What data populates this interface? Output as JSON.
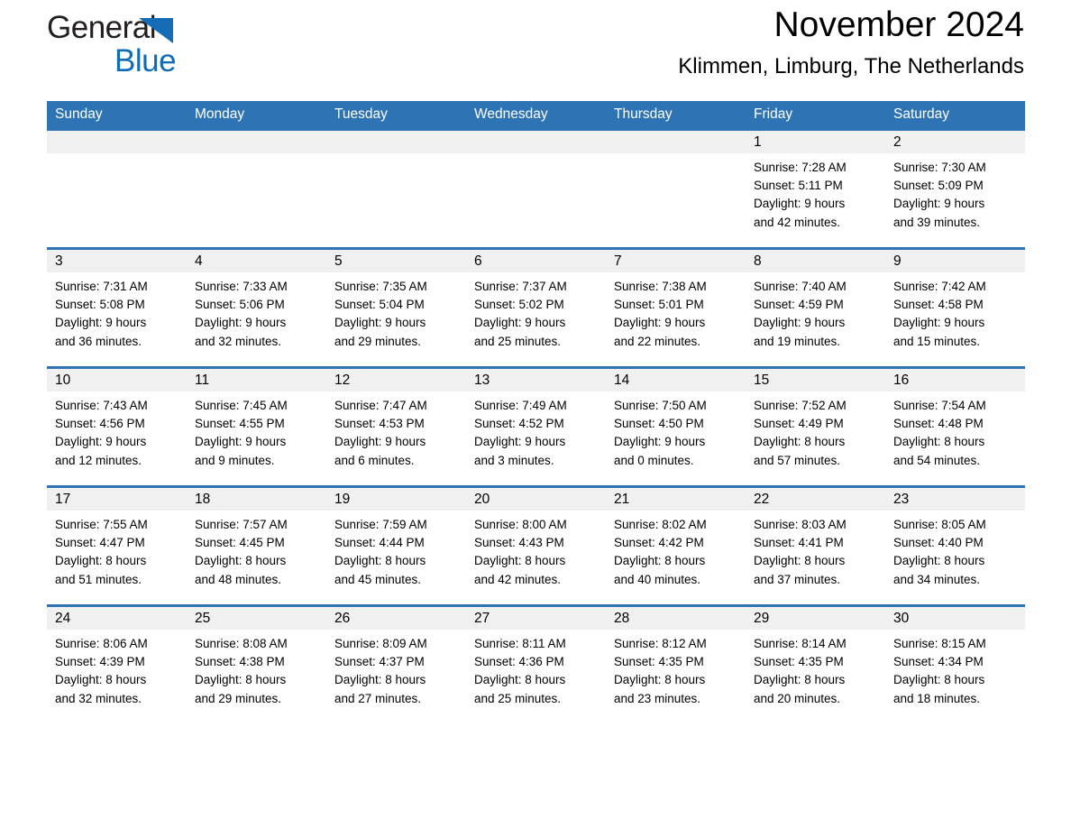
{
  "brand": {
    "name_part1": "General",
    "name_part2": "Blue",
    "triangle_color": "#146cb4",
    "text_color": "#231f20",
    "blue_color": "#0f6cb6"
  },
  "header": {
    "title": "November 2024",
    "subtitle": "Klimmen, Limburg, The Netherlands"
  },
  "theme": {
    "header_blue": "#2e74b5",
    "day_head_gray": "#f0f0f0",
    "cell_white": "#ffffff"
  },
  "weekdays": [
    "Sunday",
    "Monday",
    "Tuesday",
    "Wednesday",
    "Thursday",
    "Friday",
    "Saturday"
  ],
  "weeks": [
    [
      {
        "date": "",
        "sunrise": "",
        "sunset": "",
        "daylight1": "",
        "daylight2": ""
      },
      {
        "date": "",
        "sunrise": "",
        "sunset": "",
        "daylight1": "",
        "daylight2": ""
      },
      {
        "date": "",
        "sunrise": "",
        "sunset": "",
        "daylight1": "",
        "daylight2": ""
      },
      {
        "date": "",
        "sunrise": "",
        "sunset": "",
        "daylight1": "",
        "daylight2": ""
      },
      {
        "date": "",
        "sunrise": "",
        "sunset": "",
        "daylight1": "",
        "daylight2": ""
      },
      {
        "date": "1",
        "sunrise": "Sunrise: 7:28 AM",
        "sunset": "Sunset: 5:11 PM",
        "daylight1": "Daylight: 9 hours",
        "daylight2": "and 42 minutes."
      },
      {
        "date": "2",
        "sunrise": "Sunrise: 7:30 AM",
        "sunset": "Sunset: 5:09 PM",
        "daylight1": "Daylight: 9 hours",
        "daylight2": "and 39 minutes."
      }
    ],
    [
      {
        "date": "3",
        "sunrise": "Sunrise: 7:31 AM",
        "sunset": "Sunset: 5:08 PM",
        "daylight1": "Daylight: 9 hours",
        "daylight2": "and 36 minutes."
      },
      {
        "date": "4",
        "sunrise": "Sunrise: 7:33 AM",
        "sunset": "Sunset: 5:06 PM",
        "daylight1": "Daylight: 9 hours",
        "daylight2": "and 32 minutes."
      },
      {
        "date": "5",
        "sunrise": "Sunrise: 7:35 AM",
        "sunset": "Sunset: 5:04 PM",
        "daylight1": "Daylight: 9 hours",
        "daylight2": "and 29 minutes."
      },
      {
        "date": "6",
        "sunrise": "Sunrise: 7:37 AM",
        "sunset": "Sunset: 5:02 PM",
        "daylight1": "Daylight: 9 hours",
        "daylight2": "and 25 minutes."
      },
      {
        "date": "7",
        "sunrise": "Sunrise: 7:38 AM",
        "sunset": "Sunset: 5:01 PM",
        "daylight1": "Daylight: 9 hours",
        "daylight2": "and 22 minutes."
      },
      {
        "date": "8",
        "sunrise": "Sunrise: 7:40 AM",
        "sunset": "Sunset: 4:59 PM",
        "daylight1": "Daylight: 9 hours",
        "daylight2": "and 19 minutes."
      },
      {
        "date": "9",
        "sunrise": "Sunrise: 7:42 AM",
        "sunset": "Sunset: 4:58 PM",
        "daylight1": "Daylight: 9 hours",
        "daylight2": "and 15 minutes."
      }
    ],
    [
      {
        "date": "10",
        "sunrise": "Sunrise: 7:43 AM",
        "sunset": "Sunset: 4:56 PM",
        "daylight1": "Daylight: 9 hours",
        "daylight2": "and 12 minutes."
      },
      {
        "date": "11",
        "sunrise": "Sunrise: 7:45 AM",
        "sunset": "Sunset: 4:55 PM",
        "daylight1": "Daylight: 9 hours",
        "daylight2": "and 9 minutes."
      },
      {
        "date": "12",
        "sunrise": "Sunrise: 7:47 AM",
        "sunset": "Sunset: 4:53 PM",
        "daylight1": "Daylight: 9 hours",
        "daylight2": "and 6 minutes."
      },
      {
        "date": "13",
        "sunrise": "Sunrise: 7:49 AM",
        "sunset": "Sunset: 4:52 PM",
        "daylight1": "Daylight: 9 hours",
        "daylight2": "and 3 minutes."
      },
      {
        "date": "14",
        "sunrise": "Sunrise: 7:50 AM",
        "sunset": "Sunset: 4:50 PM",
        "daylight1": "Daylight: 9 hours",
        "daylight2": "and 0 minutes."
      },
      {
        "date": "15",
        "sunrise": "Sunrise: 7:52 AM",
        "sunset": "Sunset: 4:49 PM",
        "daylight1": "Daylight: 8 hours",
        "daylight2": "and 57 minutes."
      },
      {
        "date": "16",
        "sunrise": "Sunrise: 7:54 AM",
        "sunset": "Sunset: 4:48 PM",
        "daylight1": "Daylight: 8 hours",
        "daylight2": "and 54 minutes."
      }
    ],
    [
      {
        "date": "17",
        "sunrise": "Sunrise: 7:55 AM",
        "sunset": "Sunset: 4:47 PM",
        "daylight1": "Daylight: 8 hours",
        "daylight2": "and 51 minutes."
      },
      {
        "date": "18",
        "sunrise": "Sunrise: 7:57 AM",
        "sunset": "Sunset: 4:45 PM",
        "daylight1": "Daylight: 8 hours",
        "daylight2": "and 48 minutes."
      },
      {
        "date": "19",
        "sunrise": "Sunrise: 7:59 AM",
        "sunset": "Sunset: 4:44 PM",
        "daylight1": "Daylight: 8 hours",
        "daylight2": "and 45 minutes."
      },
      {
        "date": "20",
        "sunrise": "Sunrise: 8:00 AM",
        "sunset": "Sunset: 4:43 PM",
        "daylight1": "Daylight: 8 hours",
        "daylight2": "and 42 minutes."
      },
      {
        "date": "21",
        "sunrise": "Sunrise: 8:02 AM",
        "sunset": "Sunset: 4:42 PM",
        "daylight1": "Daylight: 8 hours",
        "daylight2": "and 40 minutes."
      },
      {
        "date": "22",
        "sunrise": "Sunrise: 8:03 AM",
        "sunset": "Sunset: 4:41 PM",
        "daylight1": "Daylight: 8 hours",
        "daylight2": "and 37 minutes."
      },
      {
        "date": "23",
        "sunrise": "Sunrise: 8:05 AM",
        "sunset": "Sunset: 4:40 PM",
        "daylight1": "Daylight: 8 hours",
        "daylight2": "and 34 minutes."
      }
    ],
    [
      {
        "date": "24",
        "sunrise": "Sunrise: 8:06 AM",
        "sunset": "Sunset: 4:39 PM",
        "daylight1": "Daylight: 8 hours",
        "daylight2": "and 32 minutes."
      },
      {
        "date": "25",
        "sunrise": "Sunrise: 8:08 AM",
        "sunset": "Sunset: 4:38 PM",
        "daylight1": "Daylight: 8 hours",
        "daylight2": "and 29 minutes."
      },
      {
        "date": "26",
        "sunrise": "Sunrise: 8:09 AM",
        "sunset": "Sunset: 4:37 PM",
        "daylight1": "Daylight: 8 hours",
        "daylight2": "and 27 minutes."
      },
      {
        "date": "27",
        "sunrise": "Sunrise: 8:11 AM",
        "sunset": "Sunset: 4:36 PM",
        "daylight1": "Daylight: 8 hours",
        "daylight2": "and 25 minutes."
      },
      {
        "date": "28",
        "sunrise": "Sunrise: 8:12 AM",
        "sunset": "Sunset: 4:35 PM",
        "daylight1": "Daylight: 8 hours",
        "daylight2": "and 23 minutes."
      },
      {
        "date": "29",
        "sunrise": "Sunrise: 8:14 AM",
        "sunset": "Sunset: 4:35 PM",
        "daylight1": "Daylight: 8 hours",
        "daylight2": "and 20 minutes."
      },
      {
        "date": "30",
        "sunrise": "Sunrise: 8:15 AM",
        "sunset": "Sunset: 4:34 PM",
        "daylight1": "Daylight: 8 hours",
        "daylight2": "and 18 minutes."
      }
    ]
  ]
}
